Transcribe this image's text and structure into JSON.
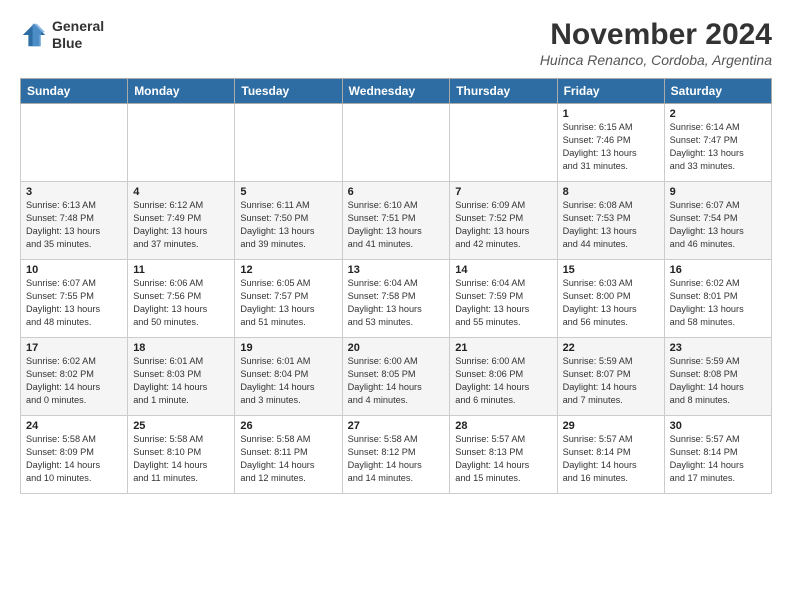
{
  "logo": {
    "line1": "General",
    "line2": "Blue"
  },
  "title": "November 2024",
  "location": "Huinca Renanco, Cordoba, Argentina",
  "weekdays": [
    "Sunday",
    "Monday",
    "Tuesday",
    "Wednesday",
    "Thursday",
    "Friday",
    "Saturday"
  ],
  "weeks": [
    [
      {
        "day": "",
        "info": ""
      },
      {
        "day": "",
        "info": ""
      },
      {
        "day": "",
        "info": ""
      },
      {
        "day": "",
        "info": ""
      },
      {
        "day": "",
        "info": ""
      },
      {
        "day": "1",
        "info": "Sunrise: 6:15 AM\nSunset: 7:46 PM\nDaylight: 13 hours\nand 31 minutes."
      },
      {
        "day": "2",
        "info": "Sunrise: 6:14 AM\nSunset: 7:47 PM\nDaylight: 13 hours\nand 33 minutes."
      }
    ],
    [
      {
        "day": "3",
        "info": "Sunrise: 6:13 AM\nSunset: 7:48 PM\nDaylight: 13 hours\nand 35 minutes."
      },
      {
        "day": "4",
        "info": "Sunrise: 6:12 AM\nSunset: 7:49 PM\nDaylight: 13 hours\nand 37 minutes."
      },
      {
        "day": "5",
        "info": "Sunrise: 6:11 AM\nSunset: 7:50 PM\nDaylight: 13 hours\nand 39 minutes."
      },
      {
        "day": "6",
        "info": "Sunrise: 6:10 AM\nSunset: 7:51 PM\nDaylight: 13 hours\nand 41 minutes."
      },
      {
        "day": "7",
        "info": "Sunrise: 6:09 AM\nSunset: 7:52 PM\nDaylight: 13 hours\nand 42 minutes."
      },
      {
        "day": "8",
        "info": "Sunrise: 6:08 AM\nSunset: 7:53 PM\nDaylight: 13 hours\nand 44 minutes."
      },
      {
        "day": "9",
        "info": "Sunrise: 6:07 AM\nSunset: 7:54 PM\nDaylight: 13 hours\nand 46 minutes."
      }
    ],
    [
      {
        "day": "10",
        "info": "Sunrise: 6:07 AM\nSunset: 7:55 PM\nDaylight: 13 hours\nand 48 minutes."
      },
      {
        "day": "11",
        "info": "Sunrise: 6:06 AM\nSunset: 7:56 PM\nDaylight: 13 hours\nand 50 minutes."
      },
      {
        "day": "12",
        "info": "Sunrise: 6:05 AM\nSunset: 7:57 PM\nDaylight: 13 hours\nand 51 minutes."
      },
      {
        "day": "13",
        "info": "Sunrise: 6:04 AM\nSunset: 7:58 PM\nDaylight: 13 hours\nand 53 minutes."
      },
      {
        "day": "14",
        "info": "Sunrise: 6:04 AM\nSunset: 7:59 PM\nDaylight: 13 hours\nand 55 minutes."
      },
      {
        "day": "15",
        "info": "Sunrise: 6:03 AM\nSunset: 8:00 PM\nDaylight: 13 hours\nand 56 minutes."
      },
      {
        "day": "16",
        "info": "Sunrise: 6:02 AM\nSunset: 8:01 PM\nDaylight: 13 hours\nand 58 minutes."
      }
    ],
    [
      {
        "day": "17",
        "info": "Sunrise: 6:02 AM\nSunset: 8:02 PM\nDaylight: 14 hours\nand 0 minutes."
      },
      {
        "day": "18",
        "info": "Sunrise: 6:01 AM\nSunset: 8:03 PM\nDaylight: 14 hours\nand 1 minute."
      },
      {
        "day": "19",
        "info": "Sunrise: 6:01 AM\nSunset: 8:04 PM\nDaylight: 14 hours\nand 3 minutes."
      },
      {
        "day": "20",
        "info": "Sunrise: 6:00 AM\nSunset: 8:05 PM\nDaylight: 14 hours\nand 4 minutes."
      },
      {
        "day": "21",
        "info": "Sunrise: 6:00 AM\nSunset: 8:06 PM\nDaylight: 14 hours\nand 6 minutes."
      },
      {
        "day": "22",
        "info": "Sunrise: 5:59 AM\nSunset: 8:07 PM\nDaylight: 14 hours\nand 7 minutes."
      },
      {
        "day": "23",
        "info": "Sunrise: 5:59 AM\nSunset: 8:08 PM\nDaylight: 14 hours\nand 8 minutes."
      }
    ],
    [
      {
        "day": "24",
        "info": "Sunrise: 5:58 AM\nSunset: 8:09 PM\nDaylight: 14 hours\nand 10 minutes."
      },
      {
        "day": "25",
        "info": "Sunrise: 5:58 AM\nSunset: 8:10 PM\nDaylight: 14 hours\nand 11 minutes."
      },
      {
        "day": "26",
        "info": "Sunrise: 5:58 AM\nSunset: 8:11 PM\nDaylight: 14 hours\nand 12 minutes."
      },
      {
        "day": "27",
        "info": "Sunrise: 5:58 AM\nSunset: 8:12 PM\nDaylight: 14 hours\nand 14 minutes."
      },
      {
        "day": "28",
        "info": "Sunrise: 5:57 AM\nSunset: 8:13 PM\nDaylight: 14 hours\nand 15 minutes."
      },
      {
        "day": "29",
        "info": "Sunrise: 5:57 AM\nSunset: 8:14 PM\nDaylight: 14 hours\nand 16 minutes."
      },
      {
        "day": "30",
        "info": "Sunrise: 5:57 AM\nSunset: 8:14 PM\nDaylight: 14 hours\nand 17 minutes."
      }
    ]
  ]
}
